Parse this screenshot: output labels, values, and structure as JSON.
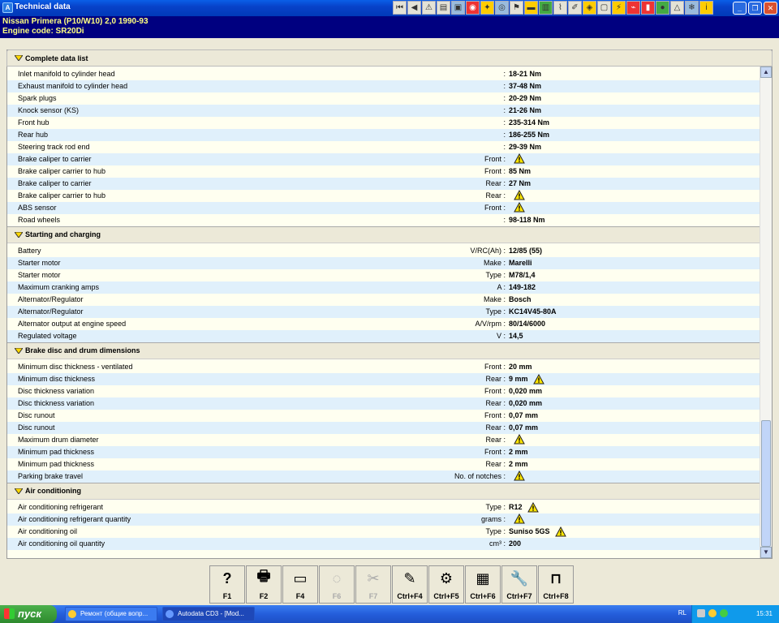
{
  "window": {
    "title": "Technical data"
  },
  "vehicle": {
    "line1": "Nissan   Primera (P10/W10) 2,0  1990-93",
    "line2": "Engine code: SR20Di"
  },
  "colors": {
    "title_bar": "#0842c9",
    "vehicle_bar": "#000080",
    "vehicle_text": "#ffff80",
    "row_alt": "#e0f0fb",
    "row_base": "#fffff0"
  },
  "tab": {
    "label": "Complete data list",
    "icon": "chevron-down-icon"
  },
  "sections": [
    {
      "header": null,
      "rows": [
        {
          "label": "Inlet manifold to cylinder head",
          "qualifier": ":",
          "value": "18-21 Nm",
          "warn": false
        },
        {
          "label": "Exhaust manifold to cylinder head",
          "qualifier": ":",
          "value": "37-48 Nm",
          "warn": false
        },
        {
          "label": "Spark plugs",
          "qualifier": ":",
          "value": "20-29 Nm",
          "warn": false
        },
        {
          "label": "Knock sensor (KS)",
          "qualifier": ":",
          "value": "21-26 Nm",
          "warn": false
        },
        {
          "label": "Front hub",
          "qualifier": ":",
          "value": "235-314 Nm",
          "warn": false
        },
        {
          "label": "Rear hub",
          "qualifier": ":",
          "value": "186-255 Nm",
          "warn": false
        },
        {
          "label": "Steering track rod end",
          "qualifier": ":",
          "value": "29-39 Nm",
          "warn": false
        },
        {
          "label": "Brake caliper to carrier",
          "qualifier": "Front :",
          "value": "",
          "warn": true
        },
        {
          "label": "Brake caliper carrier to hub",
          "qualifier": "Front :",
          "value": "85 Nm",
          "warn": false
        },
        {
          "label": "Brake caliper to carrier",
          "qualifier": "Rear :",
          "value": "27 Nm",
          "warn": false
        },
        {
          "label": "Brake caliper carrier to hub",
          "qualifier": "Rear :",
          "value": "",
          "warn": true
        },
        {
          "label": "ABS sensor",
          "qualifier": "Front :",
          "value": "",
          "warn": true
        },
        {
          "label": "Road wheels",
          "qualifier": ":",
          "value": "98-118 Nm",
          "warn": false
        }
      ]
    },
    {
      "header": "Starting and charging",
      "rows": [
        {
          "label": "Battery",
          "qualifier": "V/RC(Ah) :",
          "value": "12/85 (55)",
          "warn": false
        },
        {
          "label": "Starter motor",
          "qualifier": "Make :",
          "value": "Marelli",
          "warn": false
        },
        {
          "label": "Starter motor",
          "qualifier": "Type :",
          "value": "M78/1,4",
          "warn": false
        },
        {
          "label": "Maximum cranking amps",
          "qualifier": "A :",
          "value": "149-182",
          "warn": false
        },
        {
          "label": "Alternator/Regulator",
          "qualifier": "Make :",
          "value": "Bosch",
          "warn": false
        },
        {
          "label": "Alternator/Regulator",
          "qualifier": "Type :",
          "value": "KC14V45-80A",
          "warn": false
        },
        {
          "label": "Alternator output at engine speed",
          "qualifier": "A/V/rpm :",
          "value": "80/14/6000",
          "warn": false
        },
        {
          "label": "Regulated voltage",
          "qualifier": "V :",
          "value": "14,5",
          "warn": false
        }
      ]
    },
    {
      "header": "Brake disc and drum dimensions",
      "rows": [
        {
          "label": "Minimum disc thickness - ventilated",
          "qualifier": "Front :",
          "value": "20 mm",
          "warn": false
        },
        {
          "label": "Minimum disc thickness",
          "qualifier": "Rear :",
          "value": "9 mm",
          "warn": true
        },
        {
          "label": "Disc thickness variation",
          "qualifier": "Front :",
          "value": "0,020 mm",
          "warn": false
        },
        {
          "label": "Disc thickness variation",
          "qualifier": "Rear :",
          "value": "0,020 mm",
          "warn": false
        },
        {
          "label": "Disc runout",
          "qualifier": "Front :",
          "value": "0,07 mm",
          "warn": false
        },
        {
          "label": "Disc runout",
          "qualifier": "Rear :",
          "value": "0,07 mm",
          "warn": false
        },
        {
          "label": "Maximum drum diameter",
          "qualifier": "Rear :",
          "value": "",
          "warn": true
        },
        {
          "label": "Minimum pad thickness",
          "qualifier": "Front :",
          "value": "2 mm",
          "warn": false
        },
        {
          "label": "Minimum pad thickness",
          "qualifier": "Rear :",
          "value": "2 mm",
          "warn": false
        },
        {
          "label": "Parking brake travel",
          "qualifier": "No. of notches :",
          "value": "",
          "warn": true
        }
      ]
    },
    {
      "header": "Air conditioning",
      "rows": [
        {
          "label": "Air conditioning refrigerant",
          "qualifier": "Type :",
          "value": "R12",
          "warn": true
        },
        {
          "label": "Air conditioning refrigerant quantity",
          "qualifier": "grams :",
          "value": "",
          "warn": true
        },
        {
          "label": "Air conditioning oil",
          "qualifier": "Type :",
          "value": "Suniso 5GS",
          "warn": true
        },
        {
          "label": "Air conditioning oil quantity",
          "qualifier": "cm³ :",
          "value": "200",
          "warn": false
        }
      ]
    }
  ],
  "fkeys": [
    {
      "key": "F1",
      "icon": "help-icon",
      "glyph": "?",
      "enabled": true
    },
    {
      "key": "F2",
      "icon": "printer-icon",
      "glyph": "🖶",
      "enabled": true
    },
    {
      "key": "F4",
      "icon": "monitor-icon",
      "glyph": "▭",
      "enabled": true
    },
    {
      "key": "F6",
      "icon": "spec-icon",
      "glyph": "◌",
      "enabled": false
    },
    {
      "key": "F7",
      "icon": "tools-icon",
      "glyph": "✂",
      "enabled": false
    },
    {
      "key": "Ctrl+F4",
      "icon": "notes-icon",
      "glyph": "✎",
      "enabled": true
    },
    {
      "key": "Ctrl+F5",
      "icon": "service-icon",
      "glyph": "⚙",
      "enabled": true
    },
    {
      "key": "Ctrl+F6",
      "icon": "calculator-icon",
      "glyph": "▦",
      "enabled": true
    },
    {
      "key": "Ctrl+F7",
      "icon": "wrench-icon",
      "glyph": "🔧",
      "enabled": true
    },
    {
      "key": "Ctrl+F8",
      "icon": "lift-icon",
      "glyph": "⊓",
      "enabled": true
    }
  ],
  "taskbar": {
    "start_label": "пуск",
    "tasks": [
      {
        "label": "Ремонт (общие вопр...",
        "active": false
      },
      {
        "label": "Autodata CD3 - [Mod...",
        "active": true
      }
    ],
    "language": "RL",
    "clock": "15:31"
  }
}
